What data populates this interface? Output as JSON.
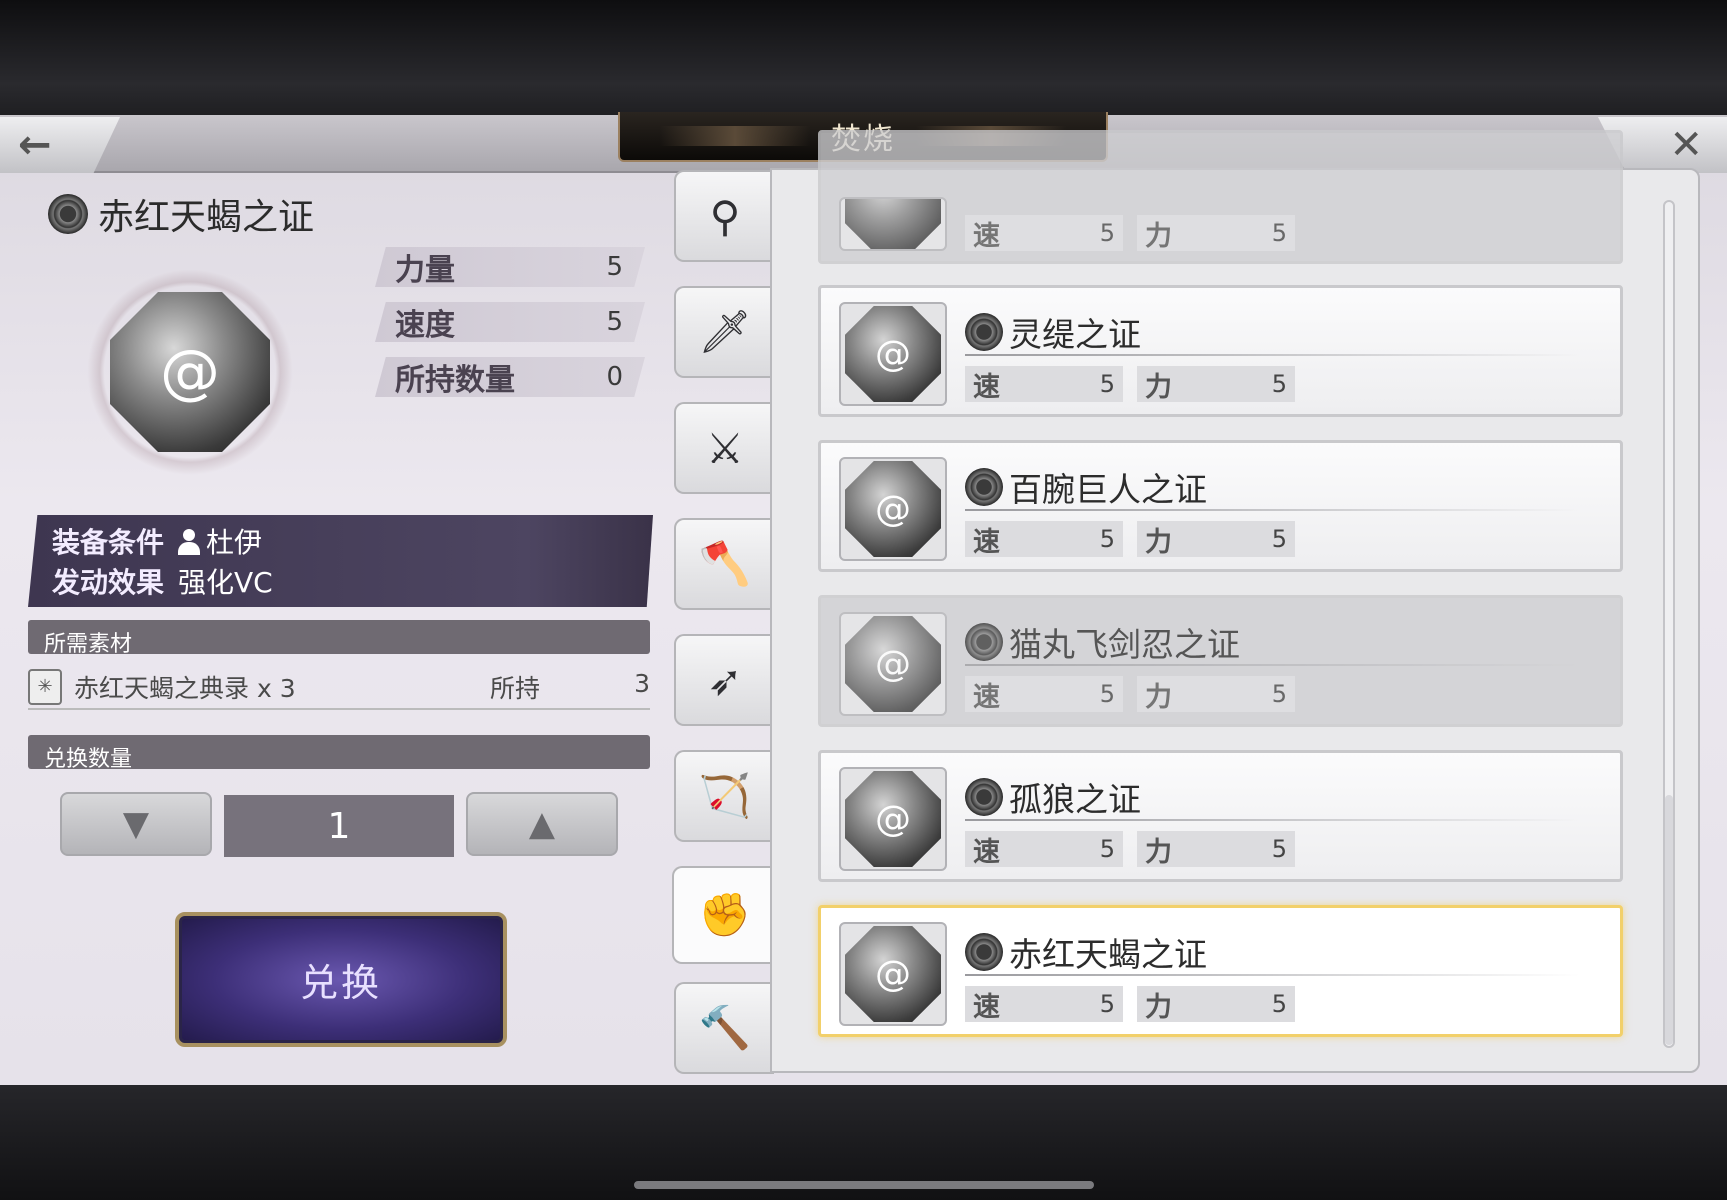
{
  "header": {
    "title": "焚烧",
    "back_icon": "←",
    "close_icon": "✕"
  },
  "detail": {
    "name": "赤红天蝎之证",
    "stats": [
      {
        "label": "力量",
        "value": "5"
      },
      {
        "label": "速度",
        "value": "5"
      },
      {
        "label": "所持数量",
        "value": "0"
      }
    ],
    "equip_condition_label": "装备条件",
    "equip_condition_value": "杜伊",
    "effect_label": "发动效果",
    "effect_value": "强化VC",
    "materials_header": "所需素材",
    "material": {
      "name": "赤红天蝎之典录 x 3",
      "held_label": "所持",
      "held_value": "3"
    },
    "quantity_header": "兑换数量",
    "quantity_value": "1",
    "down_arrow": "▼",
    "up_arrow": "▲",
    "exchange_label": "兑换"
  },
  "tabs": [
    {
      "icon": "staff-icon",
      "glyph": "⚲"
    },
    {
      "icon": "sword-icon",
      "glyph": "🗡"
    },
    {
      "icon": "katana-icon",
      "glyph": "⚔"
    },
    {
      "icon": "axe-icon",
      "glyph": "🪓"
    },
    {
      "icon": "spear-icon",
      "glyph": "➶"
    },
    {
      "icon": "bow-icon",
      "glyph": "🏹"
    },
    {
      "icon": "gauntlet-icon",
      "glyph": "✊"
    },
    {
      "icon": "hammer-icon",
      "glyph": "🔨"
    }
  ],
  "list": [
    {
      "name": "",
      "speed_label": "速",
      "speed": "5",
      "power_label": "力",
      "power": "5",
      "state": "dim"
    },
    {
      "name": "灵缇之证",
      "speed_label": "速",
      "speed": "5",
      "power_label": "力",
      "power": "5",
      "state": "normal"
    },
    {
      "name": "百腕巨人之证",
      "speed_label": "速",
      "speed": "5",
      "power_label": "力",
      "power": "5",
      "state": "normal"
    },
    {
      "name": "猫丸飞剑忍之证",
      "speed_label": "速",
      "speed": "5",
      "power_label": "力",
      "power": "5",
      "state": "dim"
    },
    {
      "name": "孤狼之证",
      "speed_label": "速",
      "speed": "5",
      "power_label": "力",
      "power": "5",
      "state": "normal"
    },
    {
      "name": "赤红天蝎之证",
      "speed_label": "速",
      "speed": "5",
      "power_label": "力",
      "power": "5",
      "state": "selected"
    }
  ],
  "colors": {
    "selected_border": "#f2d06a",
    "equip_bg": "#4d4561",
    "exchange_bg": "#3d2f78"
  }
}
